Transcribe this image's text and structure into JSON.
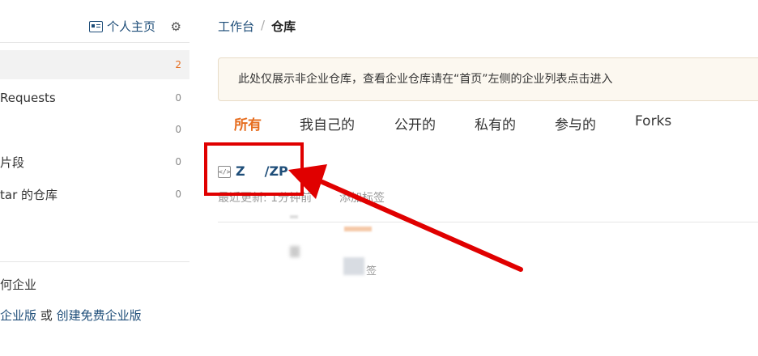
{
  "sidebar": {
    "profile_label": "个人主页",
    "items": [
      {
        "label": "",
        "count": "2"
      },
      {
        "label": "Requests",
        "count": "0"
      },
      {
        "label": "",
        "count": "0"
      },
      {
        "label": "片段",
        "count": "0"
      },
      {
        "label": "tar 的仓库",
        "count": "0"
      }
    ],
    "enterprise_link": "何企业",
    "bottom_prefix": "企业版",
    "bottom_or": " 或 ",
    "bottom_create": "创建免费企业版"
  },
  "breadcrumb": {
    "parent": "工作台",
    "separator": "/",
    "current": "仓库"
  },
  "notice": {
    "text": "此处仅展示非企业仓库，查看企业仓库请在“首页”左侧的企业列表点击进入"
  },
  "tabs": [
    {
      "label": "所有"
    },
    {
      "label": "我自己的"
    },
    {
      "label": "公开的"
    },
    {
      "label": "私有的"
    },
    {
      "label": "参与的"
    },
    {
      "label": "Forks"
    }
  ],
  "repo": {
    "icon_glyph": "</>",
    "name_left": "Z",
    "name_right": "/ZP",
    "updated": "最近更新: 1分钟前",
    "add_tag": "添加标签",
    "blur_tag": "签"
  },
  "colors": {
    "accent": "#e66d1f",
    "link": "#1f4e79",
    "annotation": "#e00000"
  }
}
